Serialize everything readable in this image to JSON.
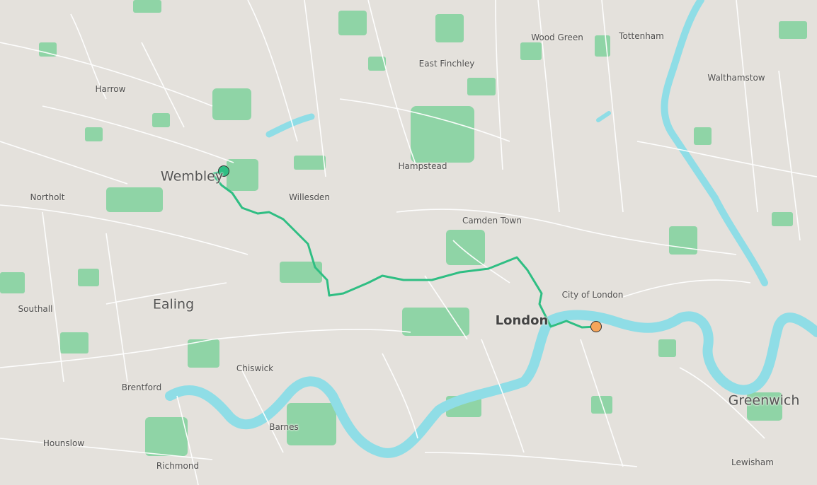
{
  "labels": {
    "wood_green": "Wood Green",
    "tottenham": "Tottenham",
    "east_finchley": "East Finchley",
    "harrow": "Harrow",
    "walthamstow": "Walthamstow",
    "hampstead": "Hampstead",
    "wembley": "Wembley",
    "northolt": "Northolt",
    "willesden": "Willesden",
    "camden_town": "Camden Town",
    "city_of_london": "City of London",
    "southall": "Southall",
    "ealing": "Ealing",
    "london": "London",
    "chiswick": "Chiswick",
    "brentford": "Brentford",
    "greenwich": "Greenwich",
    "barnes": "Barnes",
    "hounslow": "Hounslow",
    "richmond": "Richmond",
    "lewisham": "Lewisham"
  },
  "route": {
    "color": "#2fbe83",
    "start_marker_color": "#2fbe83",
    "end_marker_color": "#f6a55a"
  },
  "colors": {
    "land": "#e4e1dc",
    "water": "#8fdde6",
    "park": "#8fd4a6",
    "road": "#ffffff"
  }
}
